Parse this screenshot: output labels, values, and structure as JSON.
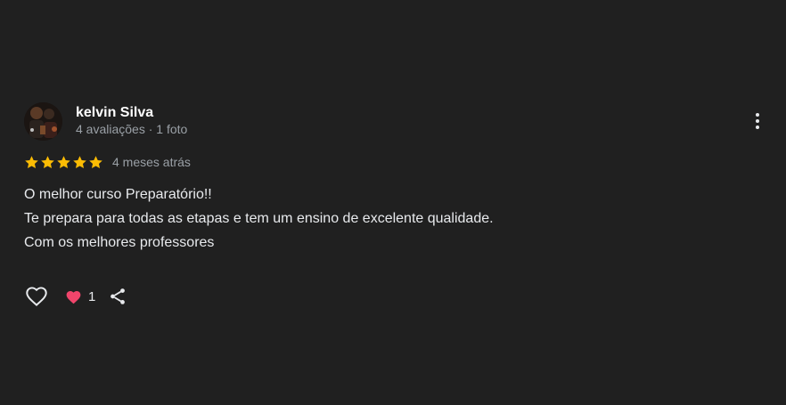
{
  "review": {
    "author_name": "kelvin Silva",
    "author_meta": "4 avaliações · 1 foto",
    "rating": 5,
    "rating_max": 5,
    "time": "4 meses atrás",
    "text_lines": [
      "O melhor curso Preparatório!!",
      "Te prepara para todas as etapas e tem um ensino de excelente qualidade.",
      "Com os melhores professores"
    ],
    "reaction_count": "1"
  },
  "icons": {
    "avatar": "avatar",
    "more": "more-vert-icon",
    "star": "star-icon",
    "like": "heart-outline-icon",
    "reaction": "heart-filled-icon",
    "share": "share-icon"
  },
  "colors": {
    "background": "#202020",
    "star": "#fbbc04",
    "heart": "#f0456b",
    "text": "#e8eaed",
    "muted": "#9aa0a6"
  }
}
